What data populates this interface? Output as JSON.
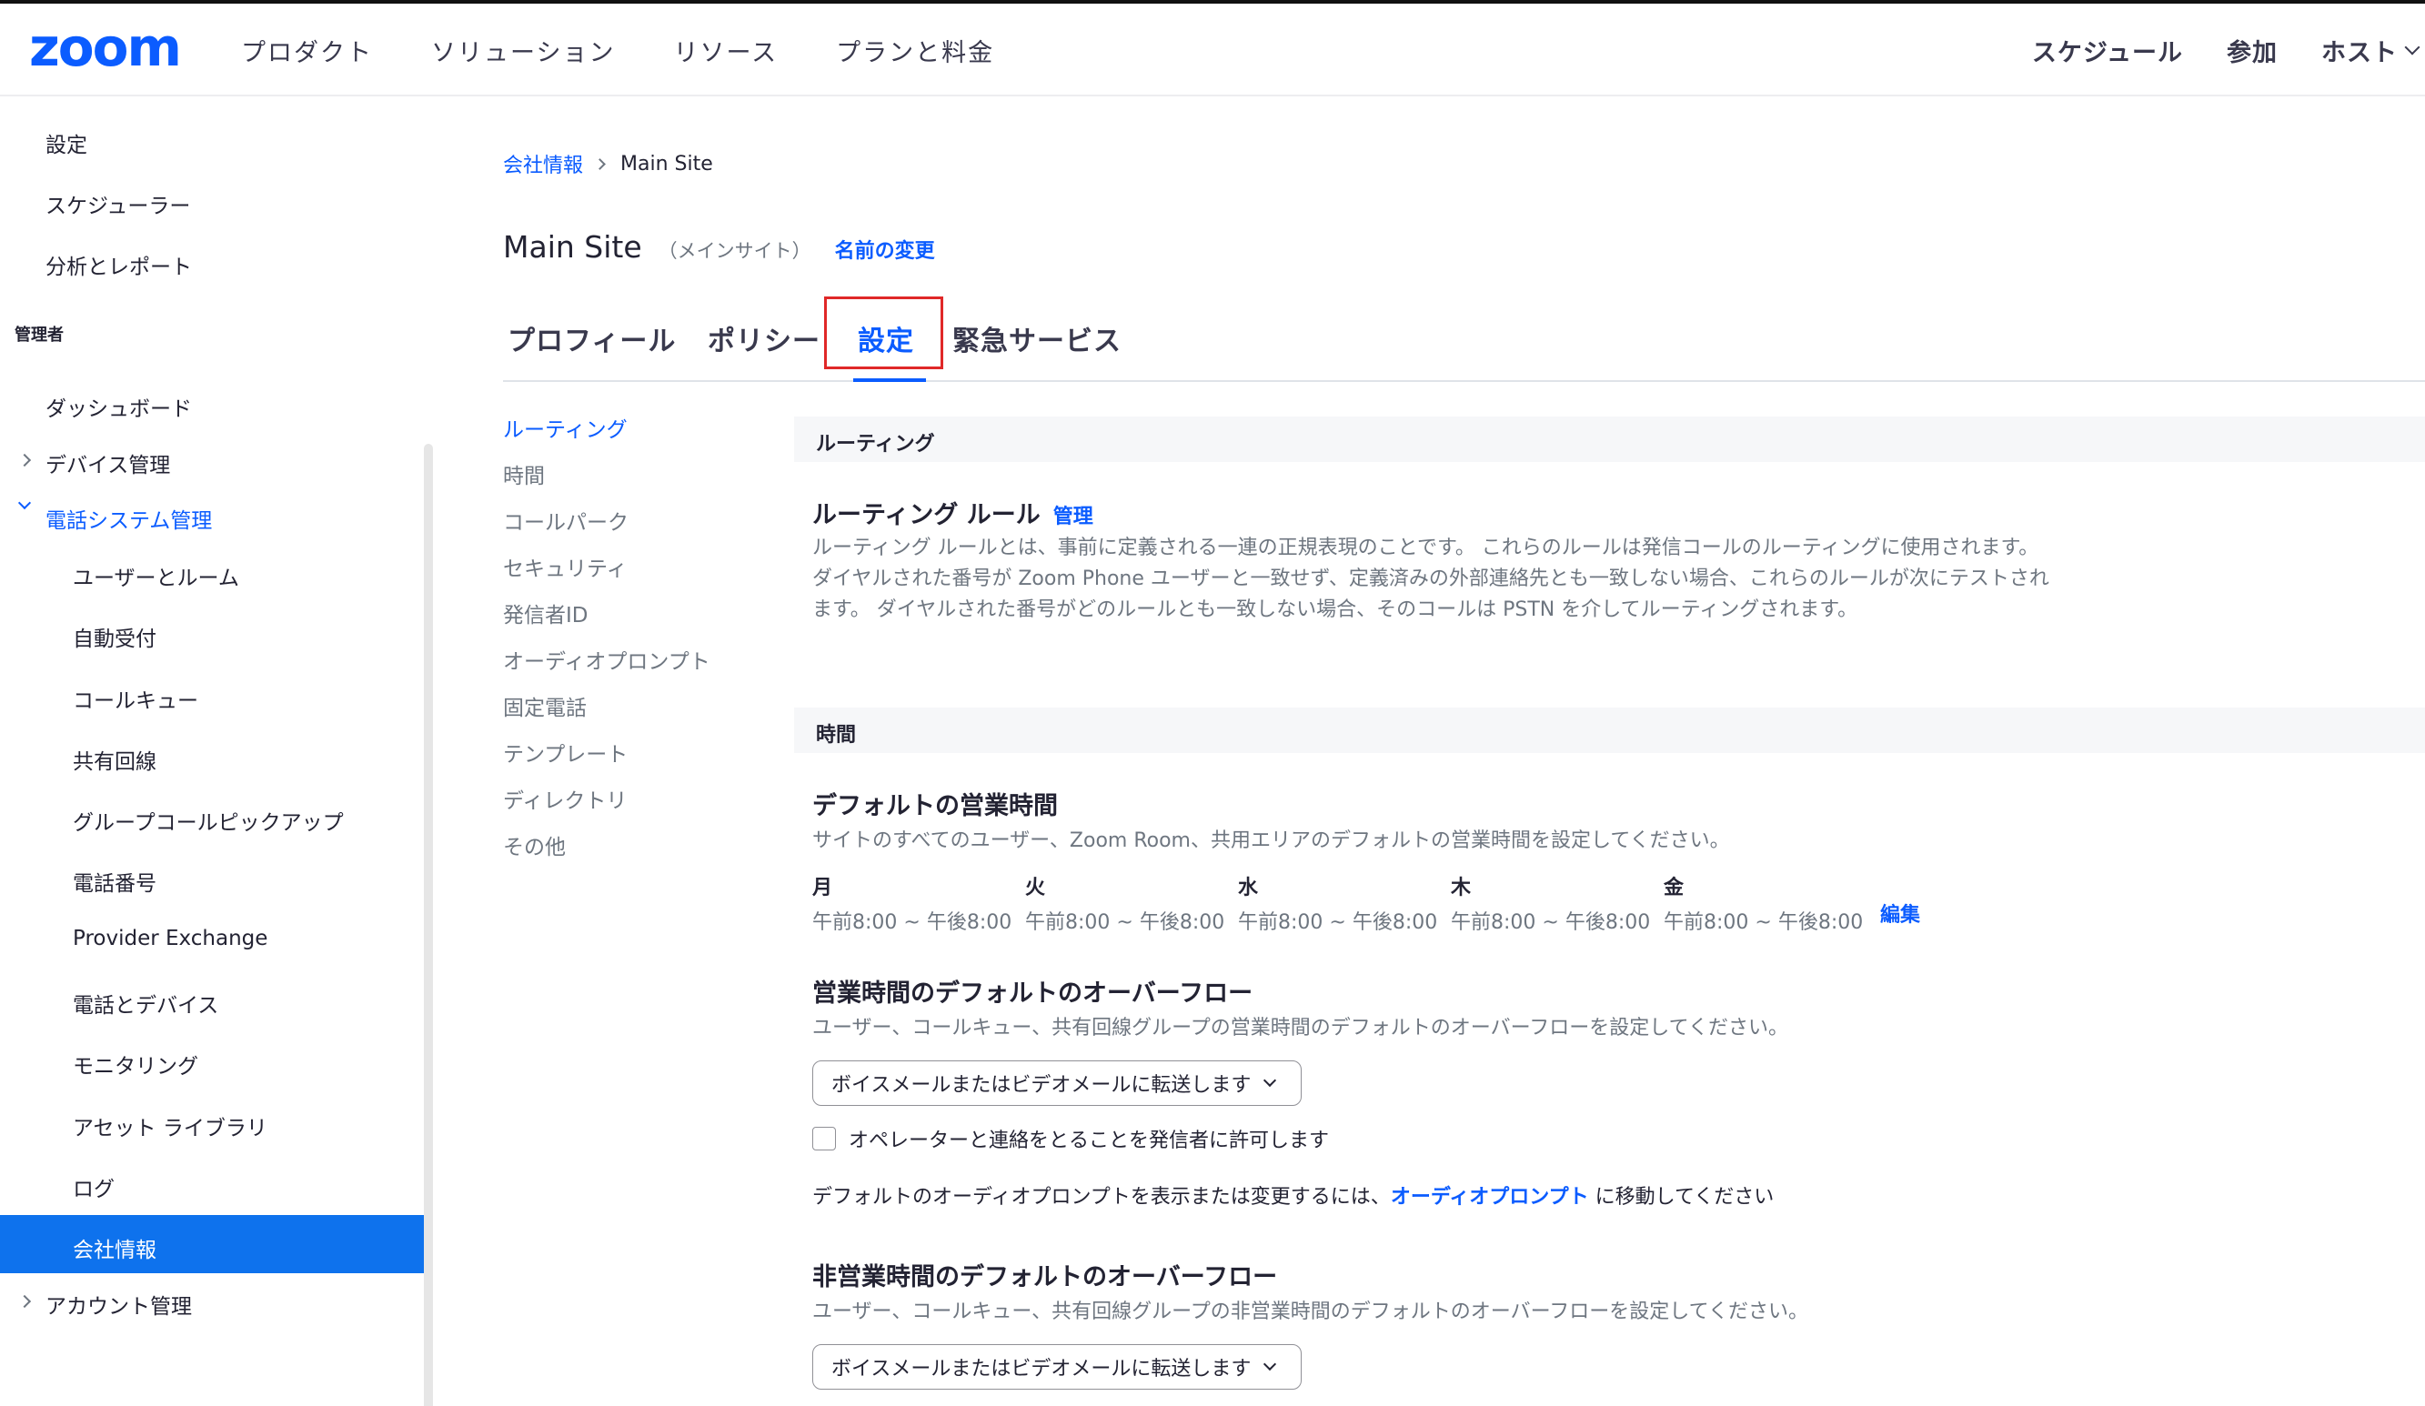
{
  "logo": "zoom",
  "topnav": {
    "left": [
      "プロダクト",
      "ソリューション",
      "リソース",
      "プランと料金"
    ],
    "schedule": "スケジュール",
    "join": "参加",
    "host": "ホスト"
  },
  "sidebar": {
    "top_items": [
      "設定",
      "スケジューラー",
      "分析とレポート"
    ],
    "admin_section": "管理者",
    "dashboard": "ダッシュボード",
    "device_mgmt": "デバイス管理",
    "phone_system": "電話システム管理",
    "phone_sub": [
      "ユーザーとルーム",
      "自動受付",
      "コールキュー",
      "共有回線",
      "グループコールピックアップ",
      "電話番号",
      "Provider Exchange",
      "電話とデバイス",
      "モニタリング",
      "アセット ライブラリ",
      "ログ",
      "会社情報"
    ],
    "account_mgmt": "アカウント管理"
  },
  "breadcrumb": {
    "parent": "会社情報",
    "current": "Main Site"
  },
  "page": {
    "title": "Main Site",
    "subtitle": "（メインサイト）",
    "rename": "名前の変更"
  },
  "tabs": [
    "プロフィール",
    "ポリシー",
    "設定",
    "緊急サービス"
  ],
  "subnav": [
    "ルーティング",
    "時間",
    "コールパーク",
    "セキュリティ",
    "発信者ID",
    "オーディオプロンプト",
    "固定電話",
    "テンプレート",
    "ディレクトリ",
    "その他"
  ],
  "routing": {
    "section": "ルーティング",
    "rule_title": "ルーティング ルール",
    "manage": "管理",
    "desc": "ルーティング ルールとは、事前に定義される一連の正規表現のことです。 これらのルールは発信コールのルーティングに使用されます。 ダイヤルされた番号が Zoom Phone ユーザーと一致せず、定義済みの外部連絡先とも一致しない場合、これらのルールが次にテストされます。 ダイヤルされた番号がどのルールとも一致しない場合、そのコールは PSTN を介してルーティングされます。"
  },
  "time": {
    "section": "時間",
    "default_hours_title": "デフォルトの営業時間",
    "default_hours_desc": "サイトのすべてのユーザー、Zoom Room、共用エリアのデフォルトの営業時間を設定してください。",
    "days": [
      {
        "day": "月",
        "time": "午前8:00 ~ 午後8:00"
      },
      {
        "day": "火",
        "time": "午前8:00 ~ 午後8:00"
      },
      {
        "day": "水",
        "time": "午前8:00 ~ 午後8:00"
      },
      {
        "day": "木",
        "time": "午前8:00 ~ 午後8:00"
      },
      {
        "day": "金",
        "time": "午前8:00 ~ 午後8:00"
      }
    ],
    "edit": "編集",
    "business_overflow_title": "営業時間のデフォルトのオーバーフロー",
    "business_overflow_desc": "ユーザー、コールキュー、共有回線グループの営業時間のデフォルトのオーバーフローを設定してください。",
    "business_overflow_value": "ボイスメールまたはビデオメールに転送します",
    "allow_operator": "オペレーターと連絡をとることを発信者に許可します",
    "note_prefix": "デフォルトのオーディオプロンプトを表示または変更するには、",
    "note_link": "オーディオプロンプト",
    "note_suffix": "に移動してください",
    "closed_overflow_title": "非営業時間のデフォルトのオーバーフロー",
    "closed_overflow_desc": "ユーザー、コールキュー、共有回線グループの非営業時間のデフォルトのオーバーフローを設定してください。",
    "closed_overflow_value": "ボイスメールまたはビデオメールに転送します"
  },
  "colors": {
    "accent": "#0b5cff",
    "active_bg": "#0e72ed",
    "highlight": "#e02828"
  }
}
